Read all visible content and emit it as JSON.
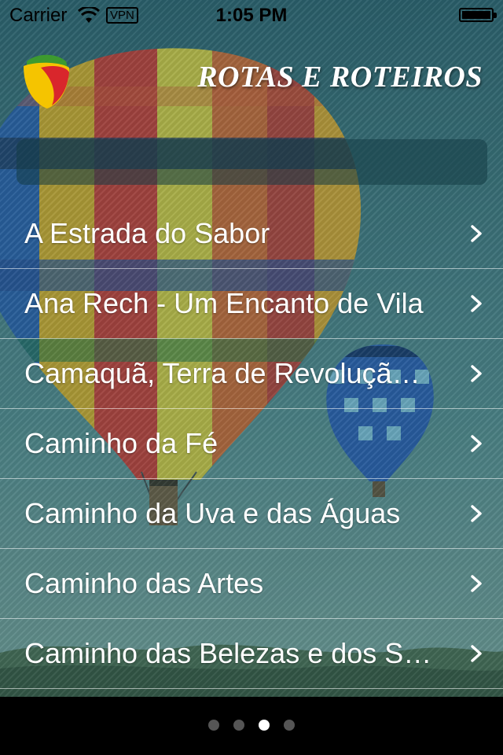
{
  "status_bar": {
    "carrier": "Carrier",
    "vpn": "VPN",
    "time": "1:05 PM"
  },
  "header": {
    "title": "ROTAS E ROTEIROS",
    "logo_icon": "regional-logo-icon"
  },
  "search": {
    "value": "",
    "placeholder": ""
  },
  "routes": [
    {
      "label": "A Estrada do Sabor"
    },
    {
      "label": "Ana Rech - Um Encanto de Vila"
    },
    {
      "label": "Camaquã, Terra de Revolução e..."
    },
    {
      "label": "Caminho da Fé"
    },
    {
      "label": "Caminho da Uva e das Águas"
    },
    {
      "label": "Caminho das Artes"
    },
    {
      "label": "Caminho das Belezas e dos Sabo..."
    }
  ],
  "pager": {
    "pages": 4,
    "current": 3
  },
  "colors": {
    "accent_yellow": "#f5c400",
    "accent_red": "#d9262c",
    "accent_green": "#3d9a2f",
    "title": "#ffffff"
  }
}
